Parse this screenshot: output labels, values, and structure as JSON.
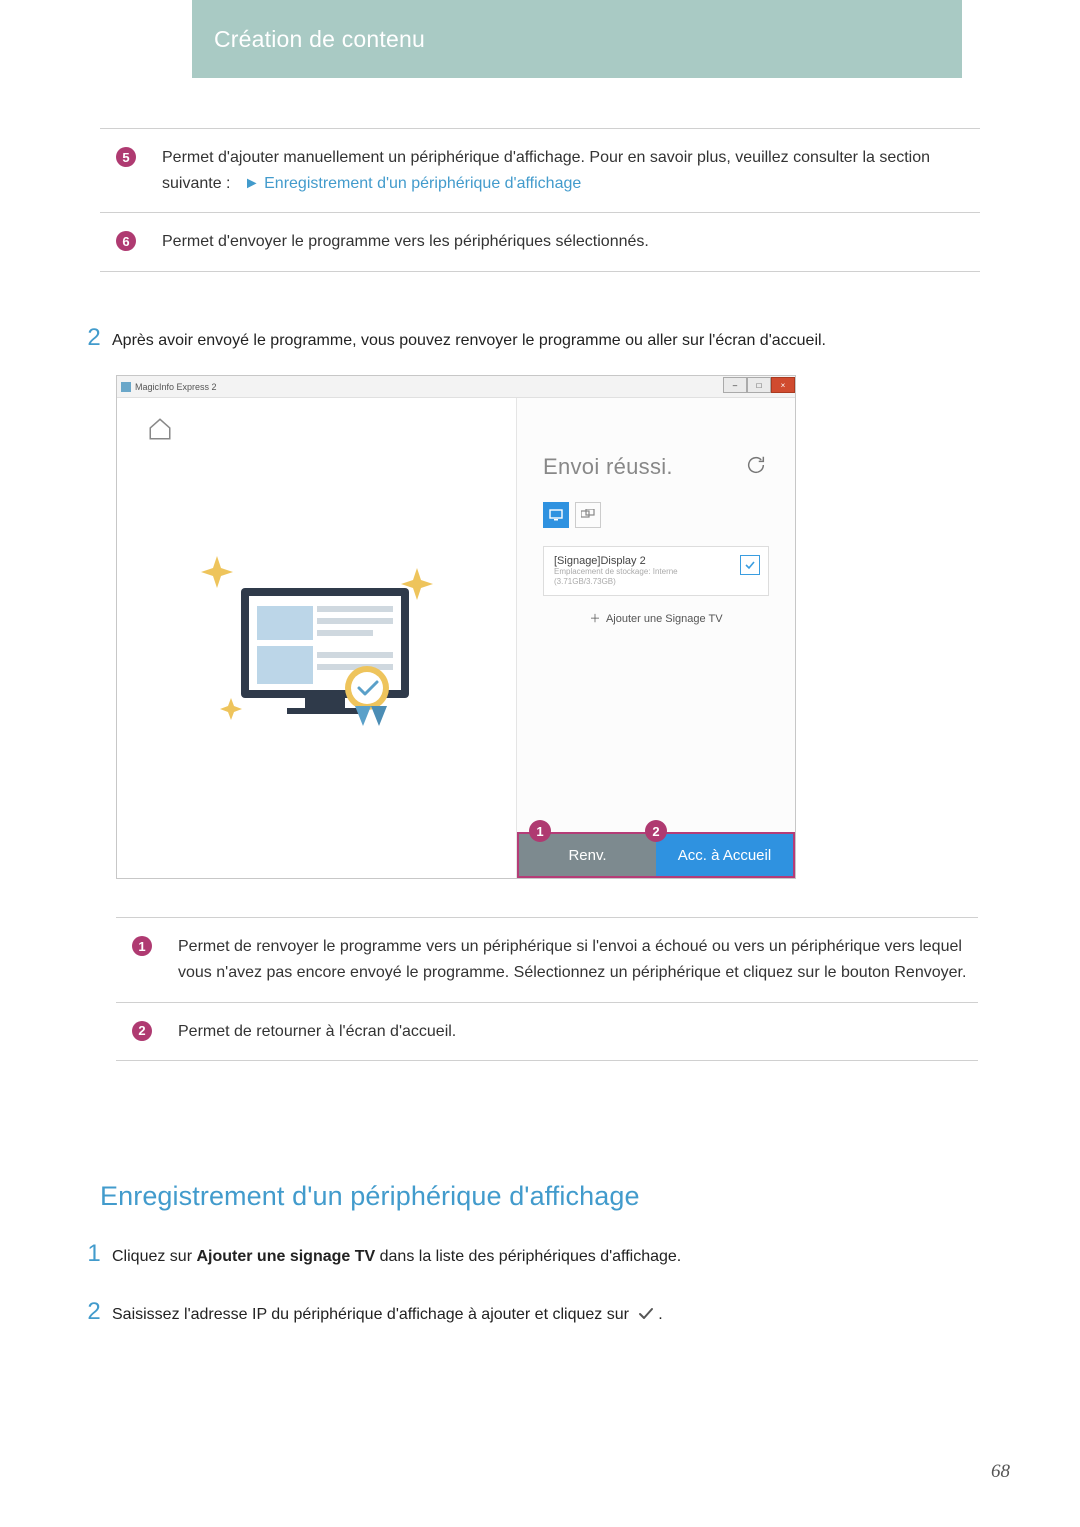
{
  "header": {
    "title": "Création de contenu"
  },
  "table1": {
    "row5": {
      "num": "5",
      "text_a": "Permet d'ajouter manuellement un périphérique d'affichage. Pour en savoir plus, veuillez consulter la section suivante :",
      "link_prefix": "►",
      "link_text": "Enregistrement d'un périphérique d'affichage"
    },
    "row6": {
      "num": "6",
      "text": "Permet d'envoyer le programme vers les périphériques sélectionnés."
    }
  },
  "step2": {
    "num": "2",
    "text": "Après avoir envoyé le programme, vous pouvez renvoyer le programme ou aller sur l'écran d'accueil."
  },
  "screenshot": {
    "window_title": "MagicInfo Express 2",
    "envoi_title": "Envoi réussi.",
    "device_name": "[Signage]Display 2",
    "device_storage_label": "Emplacement de stockage: Interne",
    "device_storage_size": "(3.71GB/3.73GB)",
    "add_device_label": "Ajouter une Signage TV",
    "btn_renv": "Renv.",
    "btn_acc": "Acc. à Accueil",
    "callout1": "1",
    "callout2": "2"
  },
  "table2": {
    "row1": {
      "num": "1",
      "text": "Permet de renvoyer le programme vers un périphérique si l'envoi a échoué ou vers un périphérique vers lequel vous n'avez pas encore envoyé le programme. Sélectionnez un périphérique et cliquez sur le bouton Renvoyer."
    },
    "row2": {
      "num": "2",
      "text": "Permet de retourner à l'écran d'accueil."
    }
  },
  "section": {
    "title": "Enregistrement d'un périphérique d'affichage",
    "step1": {
      "num": "1",
      "pre": "Cliquez sur ",
      "bold": "Ajouter une signage TV",
      "post": " dans la liste des périphériques d'affichage."
    },
    "step2": {
      "num": "2",
      "text": "Saisissez l'adresse IP du périphérique d'affichage à ajouter et cliquez sur"
    }
  },
  "page_number": "68"
}
